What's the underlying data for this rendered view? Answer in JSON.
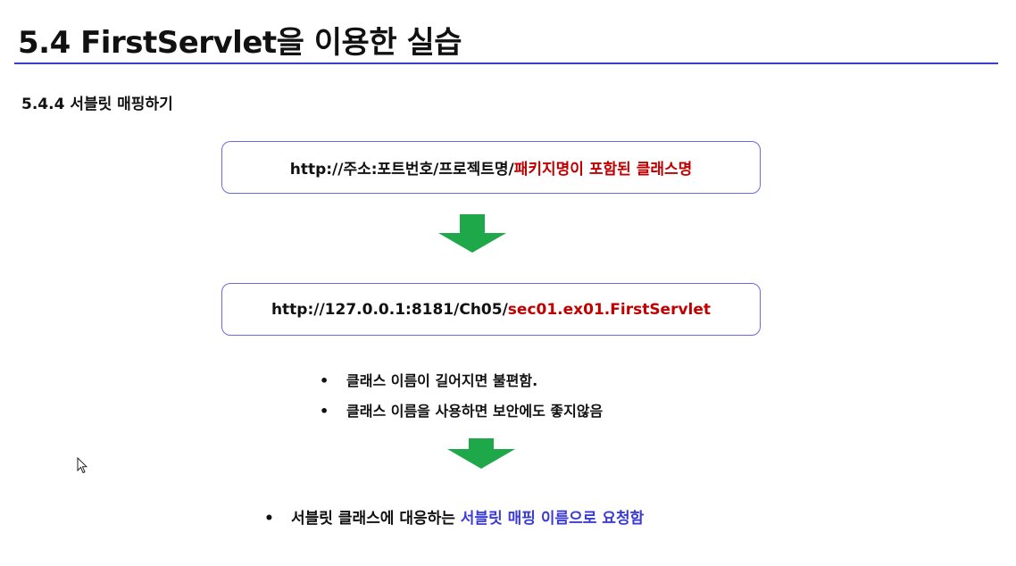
{
  "slide": {
    "title": "5.4 FirstServlet을 이용한 실습",
    "subtitle": "5.4.4  서블릿 매핑하기"
  },
  "box1": {
    "prefix": "http://주소:포트번호/프로젝트명/",
    "highlight": "패키지명이 포함된 클래스명"
  },
  "box2": {
    "prefix": "http://127.0.0.1:8181/Ch05/",
    "highlight": "sec01.ex01.FirstServlet"
  },
  "bullets": [
    "클래스 이름이 길어지면 불편함.",
    "클래스 이름을 사용하면 보안에도 좋지않음"
  ],
  "final": {
    "prefix": "서블릿 클래스에 대응하는 ",
    "highlight": "서블릿 매핑 이름으로 요청함"
  },
  "bullet_glyph": "•",
  "colors": {
    "title_rule": "#3b3bd6",
    "box_border": "#6a6ae0",
    "red_text": "#c00000",
    "blue_text": "#3b3bd6",
    "arrow": "#1fa84a"
  },
  "icons": {
    "cursor": "mouse-pointer-icon",
    "arrow": "down-arrow-icon"
  }
}
